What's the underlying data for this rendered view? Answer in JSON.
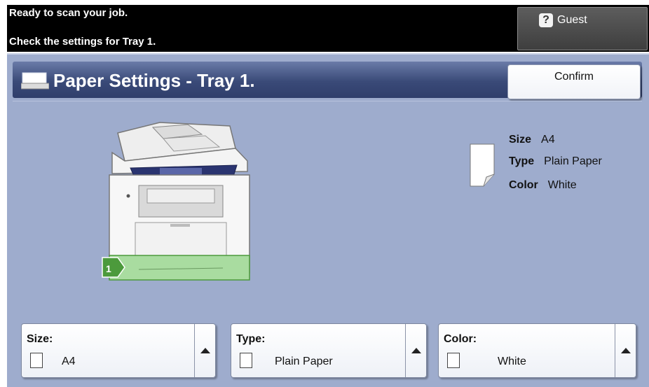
{
  "status": {
    "line1": "Ready to scan your job.",
    "line2": "Check the settings for Tray 1."
  },
  "user": {
    "label": "Guest",
    "help_icon": "?"
  },
  "header": {
    "title": "Paper Settings - Tray 1.",
    "confirm_label": "Confirm",
    "icon": "paper-tray-icon"
  },
  "illustration": {
    "tray_number": "1"
  },
  "summary": {
    "size_key": "Size",
    "size_value": "A4",
    "type_key": "Type",
    "type_value": "Plain Paper",
    "color_key": "Color",
    "color_value": "White"
  },
  "selectors": {
    "size": {
      "label": "Size:",
      "value": "A4"
    },
    "type": {
      "label": "Type:",
      "value": "Plain Paper"
    },
    "color": {
      "label": "Color:",
      "value": "White"
    }
  },
  "colors": {
    "panel_bg": "#9eaccd",
    "title_bar": "#3a4a78",
    "tray_highlight": "#a9dca0",
    "tray_badge": "#4c9a3c"
  }
}
